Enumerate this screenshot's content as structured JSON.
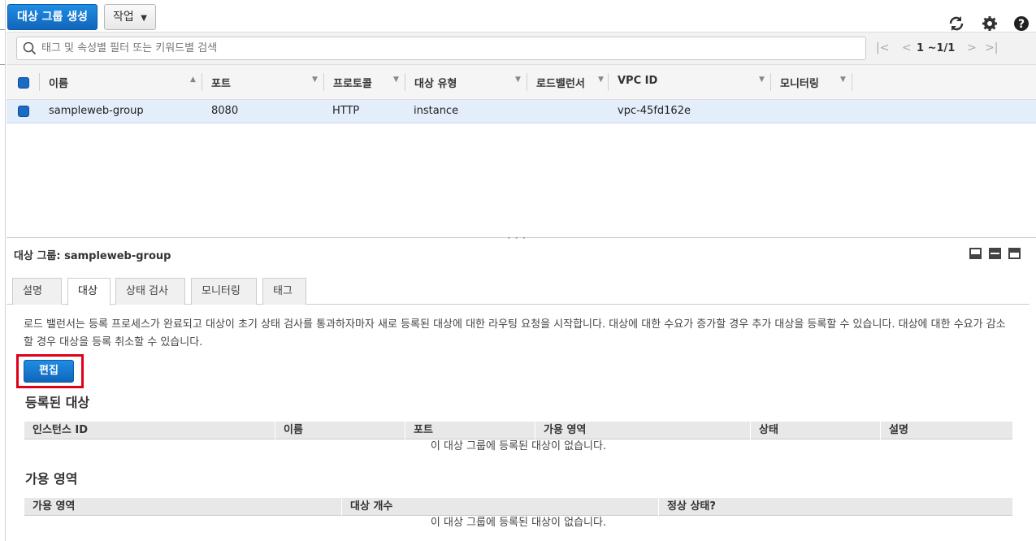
{
  "toolbar": {
    "create_label": "대상 그룹 생성",
    "actions_label": "작업"
  },
  "search": {
    "placeholder": "태그 및 속성별 필터 또는 키워드별 검색"
  },
  "pager": {
    "range": "1 ~1/1"
  },
  "grid": {
    "columns": [
      "이름",
      "포트",
      "프로토콜",
      "대상 유형",
      "로드밸런서",
      "VPC ID",
      "모니터링"
    ],
    "row": {
      "name": "sampleweb-group",
      "port": "8080",
      "protocol": "HTTP",
      "target_type": "instance",
      "load_balancer": "",
      "vpc_id": "vpc-45fd162e",
      "monitoring": ""
    }
  },
  "detail": {
    "title": "대상 그룹: sampleweb-group",
    "tabs": [
      "설명",
      "대상",
      "상태 검사",
      "모니터링",
      "태그"
    ],
    "active_tab": "대상",
    "description": "로드 밸런서는 등록 프로세스가 완료되고 대상이 초기 상태 검사를 통과하자마자 새로 등록된 대상에 대한 라우팅 요청을 시작합니다. 대상에 대한 수요가 증가할 경우 추가 대상을 등록할 수 있습니다. 대상에 대한 수요가 감소할 경우 대상을 등록 취소할 수 있습니다.",
    "edit_label": "편집",
    "registered": {
      "heading": "등록된 대상",
      "columns": [
        "인스턴스 ID",
        "이름",
        "포트",
        "가용 영역",
        "상태",
        "설명"
      ],
      "empty": "이 대상 그룹에 등록된 대상이 없습니다."
    },
    "availability": {
      "heading": "가용 영역",
      "columns": [
        "가용 영역",
        "대상 개수",
        "정상 상태?"
      ],
      "empty": "이 대상 그룹에 등록된 대상이 없습니다."
    }
  },
  "colors": {
    "primary": "#1166bb",
    "selected_row": "#e3eefa",
    "highlight": "#e1001a"
  }
}
